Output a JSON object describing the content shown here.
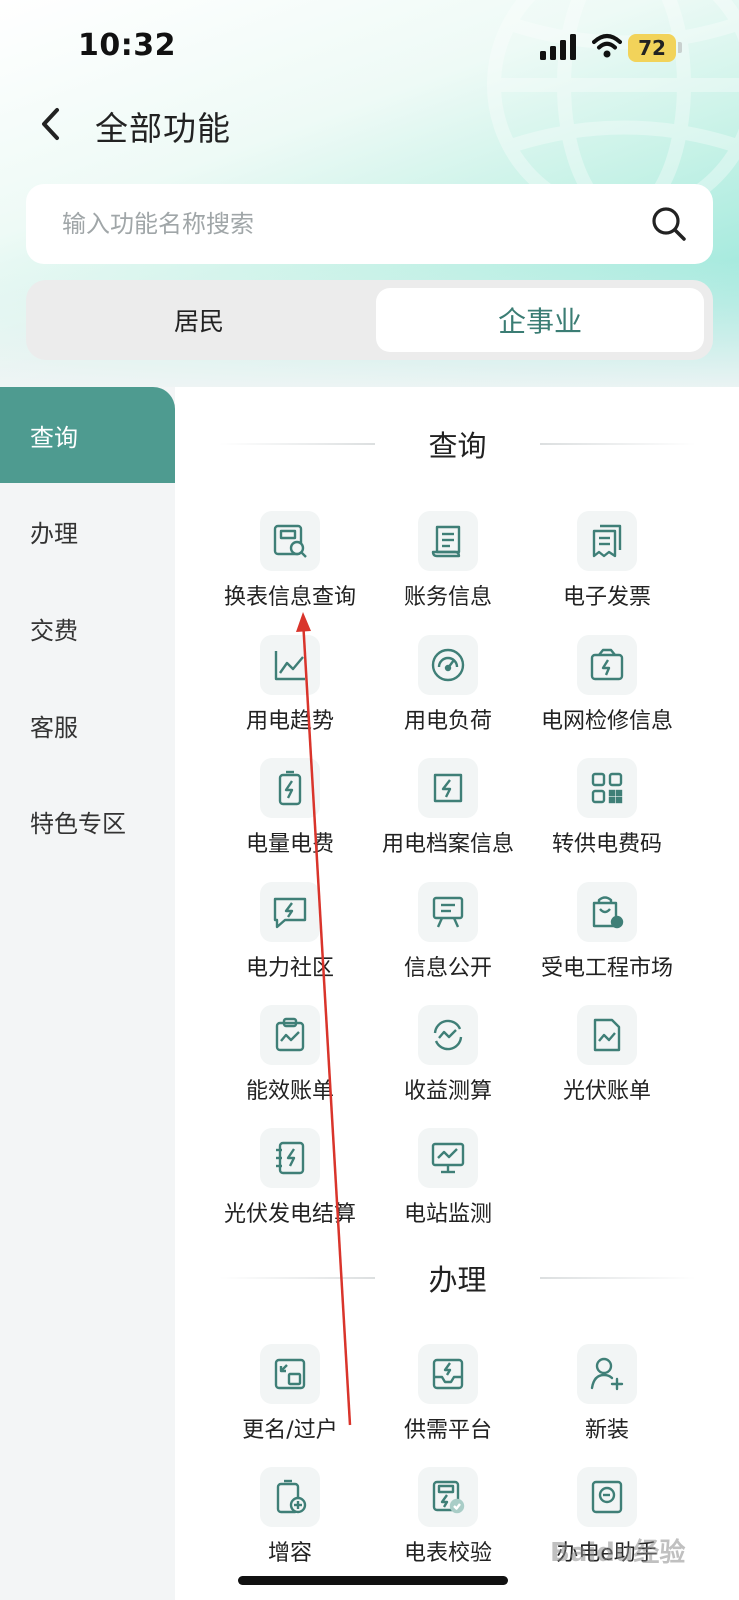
{
  "status": {
    "time": "10:32",
    "battery": "72"
  },
  "header": {
    "title": "全部功能"
  },
  "search": {
    "placeholder": "输入功能名称搜索"
  },
  "segments": {
    "left": "居民",
    "right": "企事业"
  },
  "sidebar": {
    "items": [
      {
        "label": "查询"
      },
      {
        "label": "办理"
      },
      {
        "label": "交费"
      },
      {
        "label": "客服"
      },
      {
        "label": "特色专区"
      }
    ]
  },
  "sections": [
    {
      "title": "查询",
      "items": [
        {
          "label": "换表信息查询",
          "icon": "meter-search-icon"
        },
        {
          "label": "账务信息",
          "icon": "scroll-document-icon"
        },
        {
          "label": "电子发票",
          "icon": "invoice-icon"
        },
        {
          "label": "用电趋势",
          "icon": "trend-chart-icon"
        },
        {
          "label": "用电负荷",
          "icon": "gauge-icon"
        },
        {
          "label": "电网检修信息",
          "icon": "grid-maintenance-icon"
        },
        {
          "label": "电量电费",
          "icon": "battery-bolt-icon"
        },
        {
          "label": "用电档案信息",
          "icon": "archive-bolt-icon"
        },
        {
          "label": "转供电费码",
          "icon": "qr-code-icon"
        },
        {
          "label": "电力社区",
          "icon": "chat-bolt-icon"
        },
        {
          "label": "信息公开",
          "icon": "easel-board-icon"
        },
        {
          "label": "受电工程市场",
          "icon": "shopping-bag-gear-icon"
        },
        {
          "label": "能效账单",
          "icon": "clipboard-chart-icon"
        },
        {
          "label": "收益测算",
          "icon": "cycle-chart-icon"
        },
        {
          "label": "光伏账单",
          "icon": "file-chart-icon"
        },
        {
          "label": "光伏发电结算",
          "icon": "notebook-bolt-icon"
        },
        {
          "label": "电站监测",
          "icon": "monitor-chart-icon"
        }
      ]
    },
    {
      "title": "办理",
      "items": [
        {
          "label": "更名/过户",
          "icon": "transfer-icon"
        },
        {
          "label": "供需平台",
          "icon": "tray-bolt-icon"
        },
        {
          "label": "新装",
          "icon": "add-user-icon"
        },
        {
          "label": "增容",
          "icon": "battery-plus-icon"
        },
        {
          "label": "电表校验",
          "icon": "meter-check-icon"
        },
        {
          "label": "办电e助手",
          "icon": "assistant-icon"
        }
      ]
    }
  ],
  "watermark": "Baidu经验",
  "colors": {
    "accent": "#4e9b90",
    "segment_active_text": "#3b7d74",
    "icon_stroke": "#3f7f77",
    "annotation_arrow": "#d9342b"
  }
}
